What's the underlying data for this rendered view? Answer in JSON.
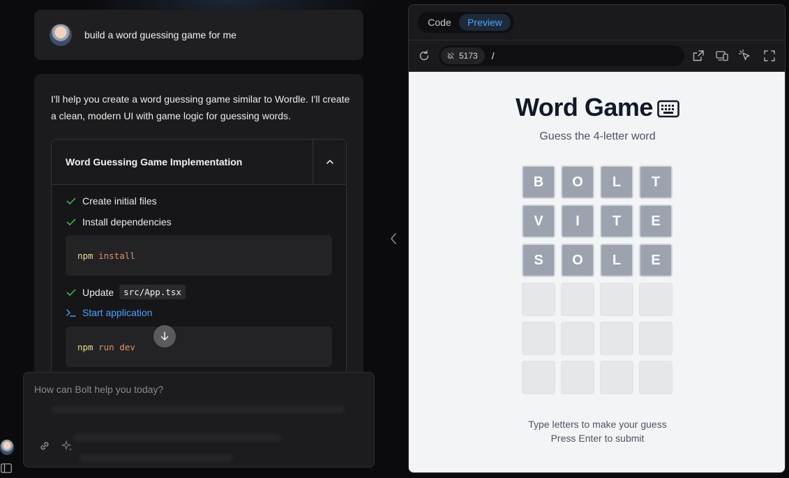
{
  "chat": {
    "user_message": "build a word guessing game for me",
    "assistant_text": "I'll help you create a word guessing game similar to Wordle. I'll create a clean, modern UI with game logic for guessing words.",
    "artifact": {
      "title": "Word Guessing Game Implementation",
      "steps": [
        {
          "label": "Create initial files"
        },
        {
          "label": "Install dependencies"
        },
        {
          "label": "Update",
          "code": "src/App.tsx"
        },
        {
          "label": "Start application"
        }
      ],
      "commands": [
        {
          "cmd": "npm",
          "args": "install"
        },
        {
          "cmd": "npm",
          "args": "run dev"
        }
      ]
    },
    "input_placeholder": "How can Bolt help you today?"
  },
  "panel": {
    "tabs": [
      "Code",
      "Preview"
    ],
    "active_tab": "Preview",
    "port": "5173",
    "path": "/"
  },
  "game": {
    "title": "Word Game",
    "subtitle": "Guess the 4-letter word",
    "rows": [
      [
        "B",
        "O",
        "L",
        "T"
      ],
      [
        "V",
        "I",
        "T",
        "E"
      ],
      [
        "S",
        "O",
        "L",
        "E"
      ],
      [
        "",
        "",
        "",
        ""
      ],
      [
        "",
        "",
        "",
        ""
      ],
      [
        "",
        "",
        "",
        ""
      ]
    ],
    "instruction_1": "Type letters to make your guess",
    "instruction_2": "Press Enter to submit"
  },
  "colors": {
    "accent": "#4aa3ff",
    "success": "#3fb950",
    "tile_filled": "#9ca3af",
    "tile_empty": "#e5e7eb"
  }
}
